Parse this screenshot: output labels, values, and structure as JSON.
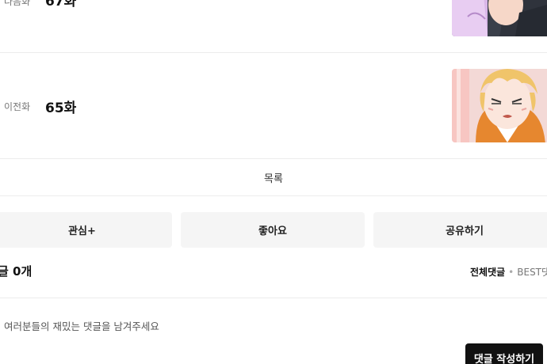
{
  "episodes": {
    "next": {
      "label": "다음화",
      "title": "67화"
    },
    "prev": {
      "label": "이전화",
      "title": "65화"
    }
  },
  "list_link": "목록",
  "actions": {
    "favorite": "관심+",
    "like": "좋아요",
    "share": "공유하기"
  },
  "comments": {
    "count_label": "글 0개",
    "sort_all": "전체댓글",
    "sort_separator": "•",
    "sort_best": "BEST댓",
    "placeholder": "여러분들의 재밌는 댓글을 남겨주세요",
    "write_button": "댓글 작성하기"
  }
}
